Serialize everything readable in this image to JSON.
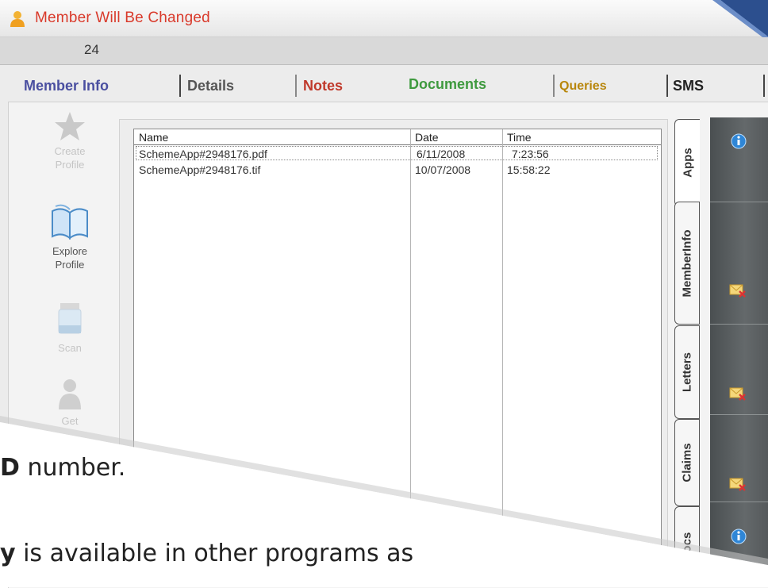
{
  "window": {
    "title": "Member Will Be Changed",
    "member_id": "24"
  },
  "tabs": [
    {
      "label": "Member Info",
      "color": "#4a4fa0"
    },
    {
      "label": "Details",
      "color": "#555555"
    },
    {
      "label": "Notes",
      "color": "#c0392b"
    },
    {
      "label": "Documents",
      "color": "#3f9a3f"
    },
    {
      "label": "Queries",
      "color": "#b8860b"
    },
    {
      "label": "SMS",
      "color": "#222222"
    }
  ],
  "toolbar": {
    "create_profile": "Create Profile",
    "explore_profile": "Explore Profile",
    "scan": "Scan",
    "get": "Get"
  },
  "documents": {
    "columns": [
      "Name",
      "Date",
      "Time"
    ],
    "rows": [
      {
        "name": "SchemeApp#2948176.pdf",
        "date": "6/11/2008",
        "time": "7:23:56"
      },
      {
        "name": "SchemeApp#2948176.tif",
        "date": "10/07/2008",
        "time": "15:58:22"
      }
    ]
  },
  "side_tabs": [
    "Apps",
    "MemberInfo",
    "Letters",
    "Claims",
    "Docs"
  ],
  "right_panel_icons": [
    "info-icon",
    "envelope-x-icon",
    "envelope-x-icon",
    "envelope-x-icon",
    "info-icon"
  ],
  "slide": {
    "line1_bold": "D",
    "line1_rest": " number.",
    "line2_bold": "y",
    "line2_rest": " is available in other programs as"
  }
}
